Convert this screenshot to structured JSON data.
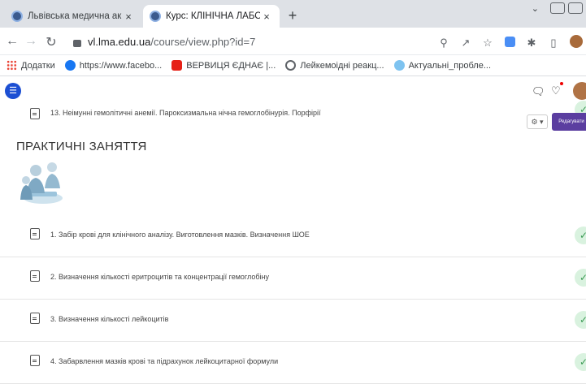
{
  "browser": {
    "tabs": [
      {
        "title": "Львівська медична академія ім",
        "active": false
      },
      {
        "title": "Курс: КЛІНІЧНА ЛАБОРАТОРНА",
        "active": true
      }
    ],
    "close_glyph": "×",
    "new_tab_glyph": "+",
    "url_host": "vl.lma.edu.ua",
    "url_path": "/course/view.php?id=7",
    "bookmarks": [
      {
        "label": "Додатки",
        "icon": "apps-grid-icon"
      },
      {
        "label": "https://www.facebo...",
        "icon": "facebook-icon"
      },
      {
        "label": "ВЕРВИЦЯ ЄДНАЄ |...",
        "icon": "youtube-icon"
      },
      {
        "label": "Лейкемоідні реакц...",
        "icon": "globe-icon"
      },
      {
        "label": "Актуальні_пробле...",
        "icon": "bookmark-favicon"
      }
    ]
  },
  "header": {
    "drawer_glyph": "☰"
  },
  "course": {
    "previous_item": "13. Неімунні гемолітичні анемії. Пароксизмальна нічна гемоглобінурія. Порфірії",
    "section_title": "ПРАКТИЧНІ ЗАНЯТТЯ",
    "edit_button": "Редагувати",
    "settings_glyph": "⚙ ▾",
    "activities": [
      {
        "label": "1. Забір крові для клінічного аналізу. Виготовлення мазків. Визначення ШОЕ",
        "done": true
      },
      {
        "label": "2. Визначення кількості еритроцитів та концентрації гемоглобіну",
        "done": true
      },
      {
        "label": "3. Визначення кількості лейкоцитів",
        "done": true
      },
      {
        "label": "4. Забарвлення мазків крові та підрахунок лейкоцитарної формули",
        "done": true
      }
    ],
    "tick_glyph": "✓"
  },
  "colors": {
    "edit_button": "#5b3ea0",
    "drawer_button": "#1c4fd3",
    "completion": "#3a9a53"
  }
}
